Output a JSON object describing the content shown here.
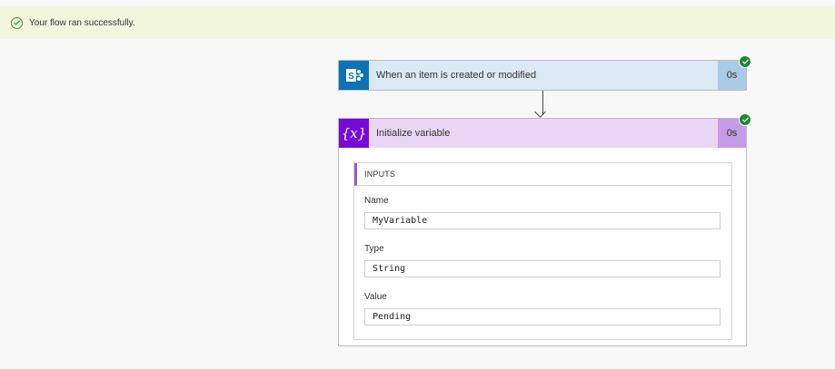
{
  "banner": {
    "message": "Your flow ran successfully.",
    "icon": "check-circle-icon",
    "status_color": "#3a8a3a"
  },
  "trigger": {
    "title": "When an item is created or modified",
    "duration": "0s",
    "icon": "sharepoint-icon",
    "icon_letter": "S",
    "accent_color": "#0b72b5"
  },
  "init_variable": {
    "title": "Initialize variable",
    "duration": "0s",
    "icon": "variable-icon",
    "icon_text": "{x}",
    "accent_color": "#770bd6",
    "inputs": {
      "header": "INPUTS",
      "fields": [
        {
          "label": "Name",
          "value": "MyVariable"
        },
        {
          "label": "Type",
          "value": "String"
        },
        {
          "label": "Value",
          "value": "Pending"
        }
      ]
    }
  },
  "success_color": "#1b8a2e"
}
